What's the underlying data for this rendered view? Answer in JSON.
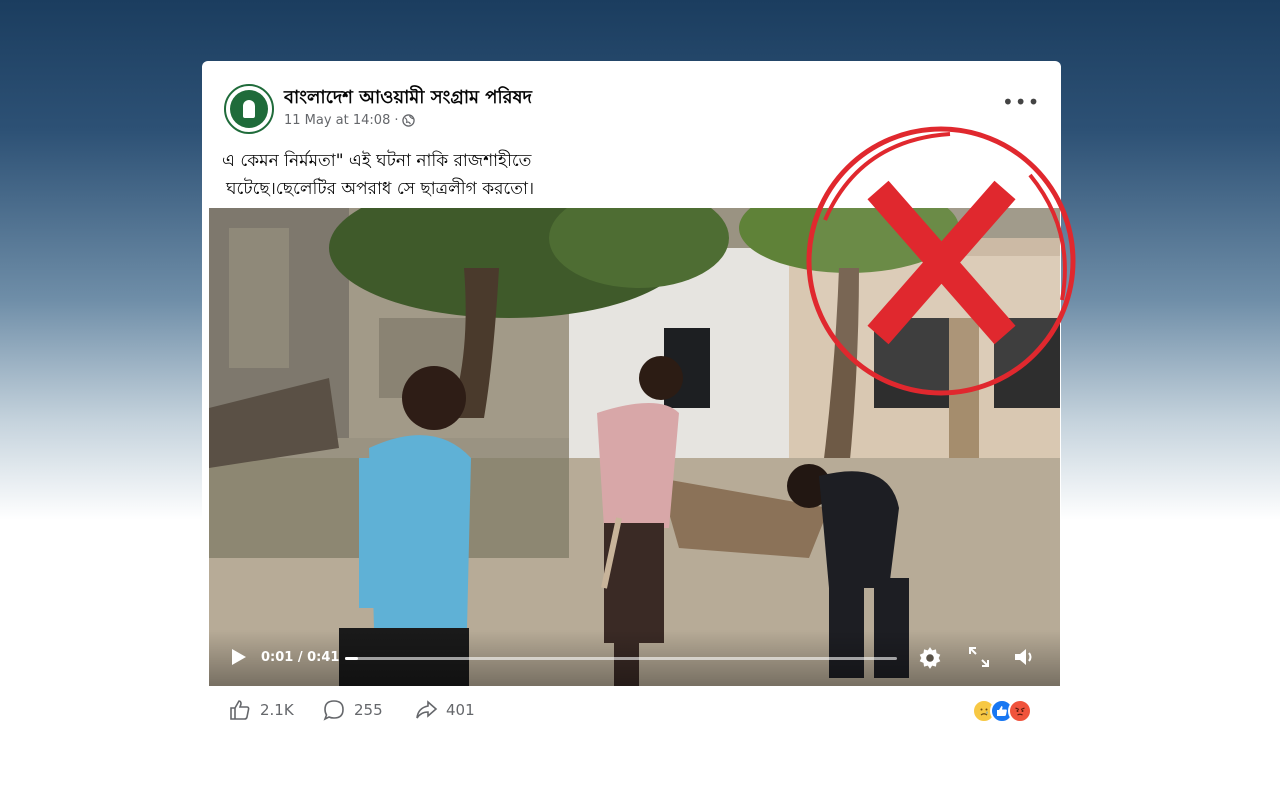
{
  "post": {
    "page_name": "বাংলাদেশ আওয়ামী সংগ্রাম পরিষদ",
    "timestamp": "11 May at 14:08",
    "visibility_icon": "globe-icon",
    "more_label": "•••",
    "caption_line1": "এ কেমন নির্মমতা\" এই ঘটনা নাকি রাজশাহীতে",
    "caption_line2": "ঘটেছে।ছেলেটির অপরাধ সে ছাত্রলীগ করতো।"
  },
  "video": {
    "time": "0:01 / 0:41",
    "progress": 0.024,
    "icons": [
      "play-icon",
      "settings-icon",
      "fullscreen-icon",
      "volume-icon"
    ]
  },
  "engagement": {
    "likes": "2.1K",
    "comments": "255",
    "shares": "401",
    "reactions": [
      "sad",
      "like",
      "angry"
    ]
  },
  "colors": {
    "stamp_red": "#e0282e",
    "progress": "#ffffff",
    "like_blue": "#1877f2",
    "angry_orange": "#f0533c",
    "sad_yellow": "#f7c844"
  }
}
